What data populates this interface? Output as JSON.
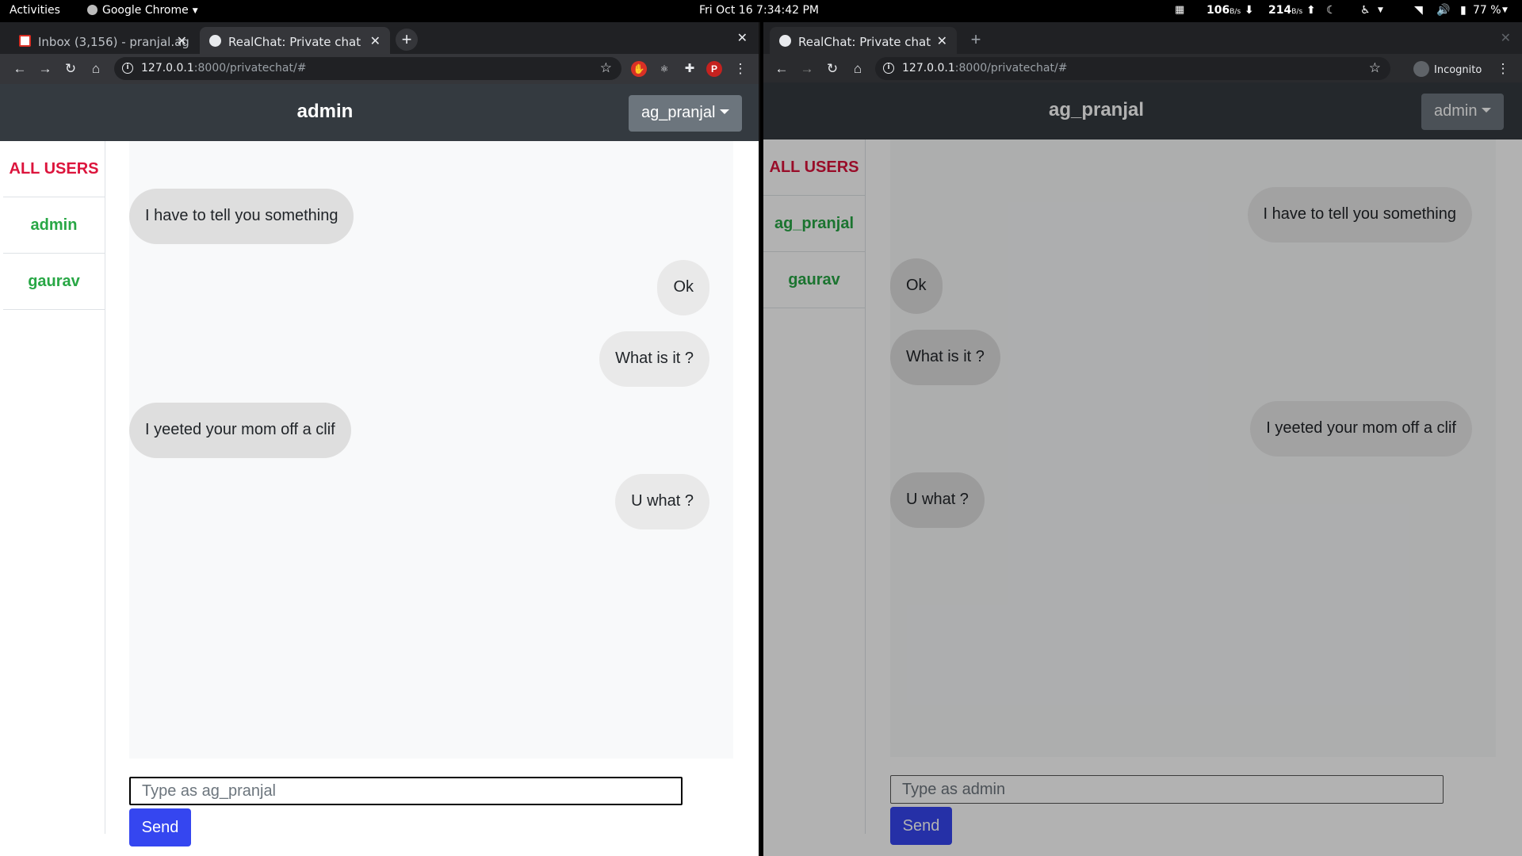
{
  "system_bar": {
    "activities": "Activities",
    "app_name": "Google Chrome",
    "clock": "Fri Oct 16  7:34:42 PM",
    "net_down_value": "106",
    "net_down_unit": "B/s",
    "net_up_value": "214",
    "net_up_unit": "B/s",
    "battery": "77 %"
  },
  "left_window": {
    "tabs": [
      {
        "label": "Inbox (3,156) - pranjal.ag"
      },
      {
        "label": "RealChat: Private chat"
      }
    ],
    "url_host": "127.0.0.1",
    "url_rest": ":8000/privatechat/#",
    "ext_profile_letter": "P",
    "page": {
      "brand": "admin",
      "dropdown_label": "ag_pranjal",
      "sidebar": [
        "ALL USERS",
        "admin",
        "gaurav"
      ],
      "messages": [
        {
          "text": "I have to tell you something",
          "side": "left"
        },
        {
          "text": "Ok",
          "side": "right"
        },
        {
          "text": "What is it ?",
          "side": "right"
        },
        {
          "text": "I yeeted your mom off a clif",
          "side": "left"
        },
        {
          "text": "U what ?",
          "side": "right"
        }
      ],
      "input_placeholder": "Type as ag_pranjal",
      "send_label": "Send"
    }
  },
  "right_window": {
    "tabs": [
      {
        "label": "RealChat: Private chat"
      }
    ],
    "url_host": "127.0.0.1",
    "url_rest": ":8000/privatechat/#",
    "incognito_label": "Incognito",
    "page": {
      "brand": "ag_pranjal",
      "dropdown_label": "admin",
      "sidebar": [
        "ALL USERS",
        "ag_pranjal",
        "gaurav"
      ],
      "messages": [
        {
          "text": "I have to tell you something",
          "side": "right"
        },
        {
          "text": "Ok",
          "side": "left"
        },
        {
          "text": "What is it ?",
          "side": "left"
        },
        {
          "text": "I yeeted your mom off a clif",
          "side": "right"
        },
        {
          "text": "U what ?",
          "side": "left"
        }
      ],
      "input_placeholder": "Type as admin",
      "send_label": "Send"
    }
  }
}
